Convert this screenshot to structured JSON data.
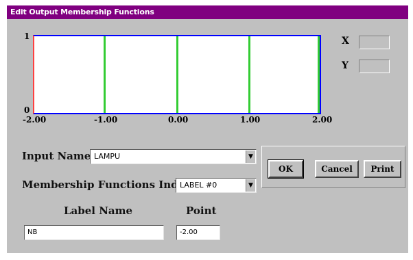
{
  "window": {
    "title": "Edit Output Membership Functions"
  },
  "plot": {
    "y_max_label": "1",
    "y_min_label": "0",
    "x_ticks": [
      "-2.00",
      "-1.00",
      "0.00",
      "1.00",
      "2.00"
    ],
    "border_color": "#0000ff",
    "left_edge_color": "#ff4040",
    "line_color": "#33cc33"
  },
  "coords": {
    "x_label": "X",
    "y_label": "Y",
    "x_value": "",
    "y_value": ""
  },
  "form": {
    "input_name_label": "Input Name",
    "input_name_value": "LAMPU",
    "mf_index_label": "Membership Functions Index",
    "mf_index_value": "LABEL #0",
    "label_name_header": "Label Name",
    "point_header": "Point",
    "label_name_value": "NB",
    "point_value": "-2.00"
  },
  "buttons": {
    "ok": "OK",
    "cancel": "Cancel",
    "print": "Print"
  }
}
